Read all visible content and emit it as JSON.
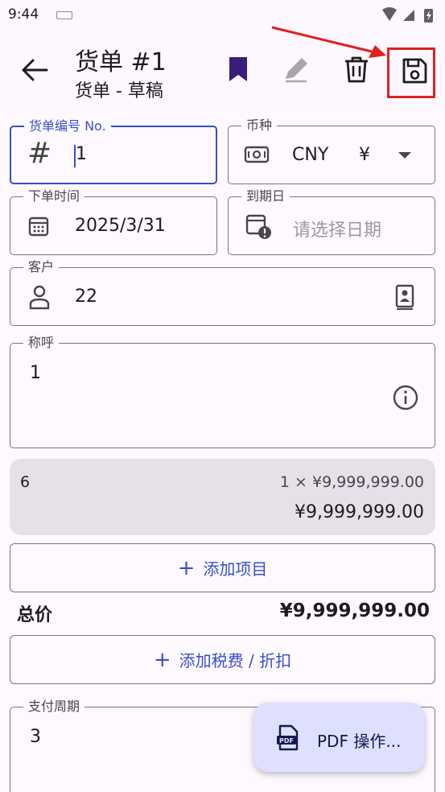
{
  "status_bar": {
    "time": "9:44"
  },
  "app_bar": {
    "title": "货单 #1",
    "subtitle": "货单 - 草稿"
  },
  "form": {
    "invoice_number": {
      "label": "货单编号 No.",
      "value": "1"
    },
    "currency": {
      "label": "币种",
      "code": "CNY",
      "symbol": "¥"
    },
    "order_date": {
      "label": "下单时间",
      "value": "2025/3/31"
    },
    "due_date": {
      "label": "到期日",
      "placeholder": "请选择日期"
    },
    "customer": {
      "label": "客户",
      "value": "22"
    },
    "salutation": {
      "label": "称呼",
      "value": "1"
    },
    "payment_terms": {
      "label": "支付周期",
      "value": "3"
    }
  },
  "items": [
    {
      "name": "6",
      "quantity_price": "1 × ¥9,999,999.00",
      "total": "¥9,999,999.00"
    }
  ],
  "actions": {
    "add_item": "添加项目",
    "add_tax_discount": "添加税费 / 折扣",
    "pdf": "PDF 操作..."
  },
  "summary": {
    "total_label": "总价",
    "total_value": "¥9,999,999.00"
  },
  "colors": {
    "accent": "#3650c8",
    "highlight_arrow": "#e02020",
    "bookmark": "#3b1d7a",
    "fab_bg": "#dfe0ff"
  }
}
